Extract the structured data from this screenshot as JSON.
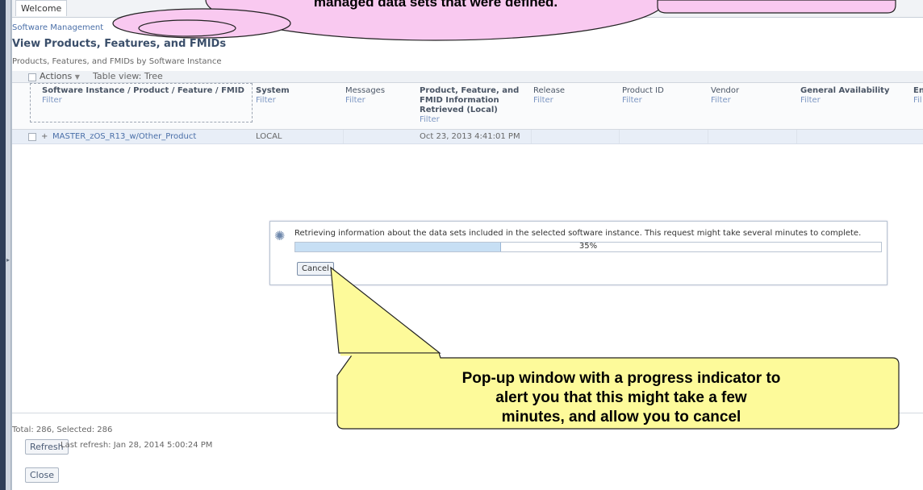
{
  "tabs": {
    "welcome": "Welcome"
  },
  "breadcrumb": {
    "first": "Software Management",
    "last": "Products, Features, and FMIDs"
  },
  "page": {
    "title": "View Products, Features, and FMIDs",
    "subtitle": "Products, Features, and FMIDs by Software Instance"
  },
  "toolbar": {
    "actions": "Actions",
    "table_view": "Table view: Tree"
  },
  "columns": {
    "c1": "Software Instance / Product / Feature / FMID",
    "c2": "System",
    "c3": "Messages",
    "c4a": "Product, Feature, and",
    "c4b": "FMID Information",
    "c4c": "Retrieved (Local)",
    "c5": "Release",
    "c6": "Product ID",
    "c7": "Vendor",
    "c8": "General Availability",
    "c9": "En",
    "filter": "Filter",
    "filter_short": "Fil"
  },
  "row": {
    "expand": "+",
    "name": "MASTER_zOS_R13_w/Other_Product",
    "system": "LOCAL",
    "retrieved": "Oct 23, 2013 4:41:01 PM"
  },
  "footer": {
    "total": "Total: 286, Selected: 286",
    "refresh": "Refresh",
    "last_refresh": "Last refresh: Jan 28, 2014 5:00:24 PM",
    "close": "Close"
  },
  "dialog": {
    "message": "Retrieving information about the data sets included in the selected software instance. This request might take several minutes to complete.",
    "progress_pct": 35,
    "progress_label": "35%",
    "cancel": "Cancel"
  },
  "callouts": {
    "top_text": "managed data sets that were defined.",
    "bottom_line1": "Pop-up window with a progress indicator to",
    "bottom_line2": "alert you that this might take a few",
    "bottom_line3": "minutes, and allow you to cancel"
  },
  "colors": {
    "callout_pink": "#f9c9f0",
    "callout_yellow": "#fdfa9a",
    "accent_link": "#4a6fa8"
  },
  "icons": {
    "spinner": "spinner-icon",
    "gutter": "chevron-right-icon"
  }
}
